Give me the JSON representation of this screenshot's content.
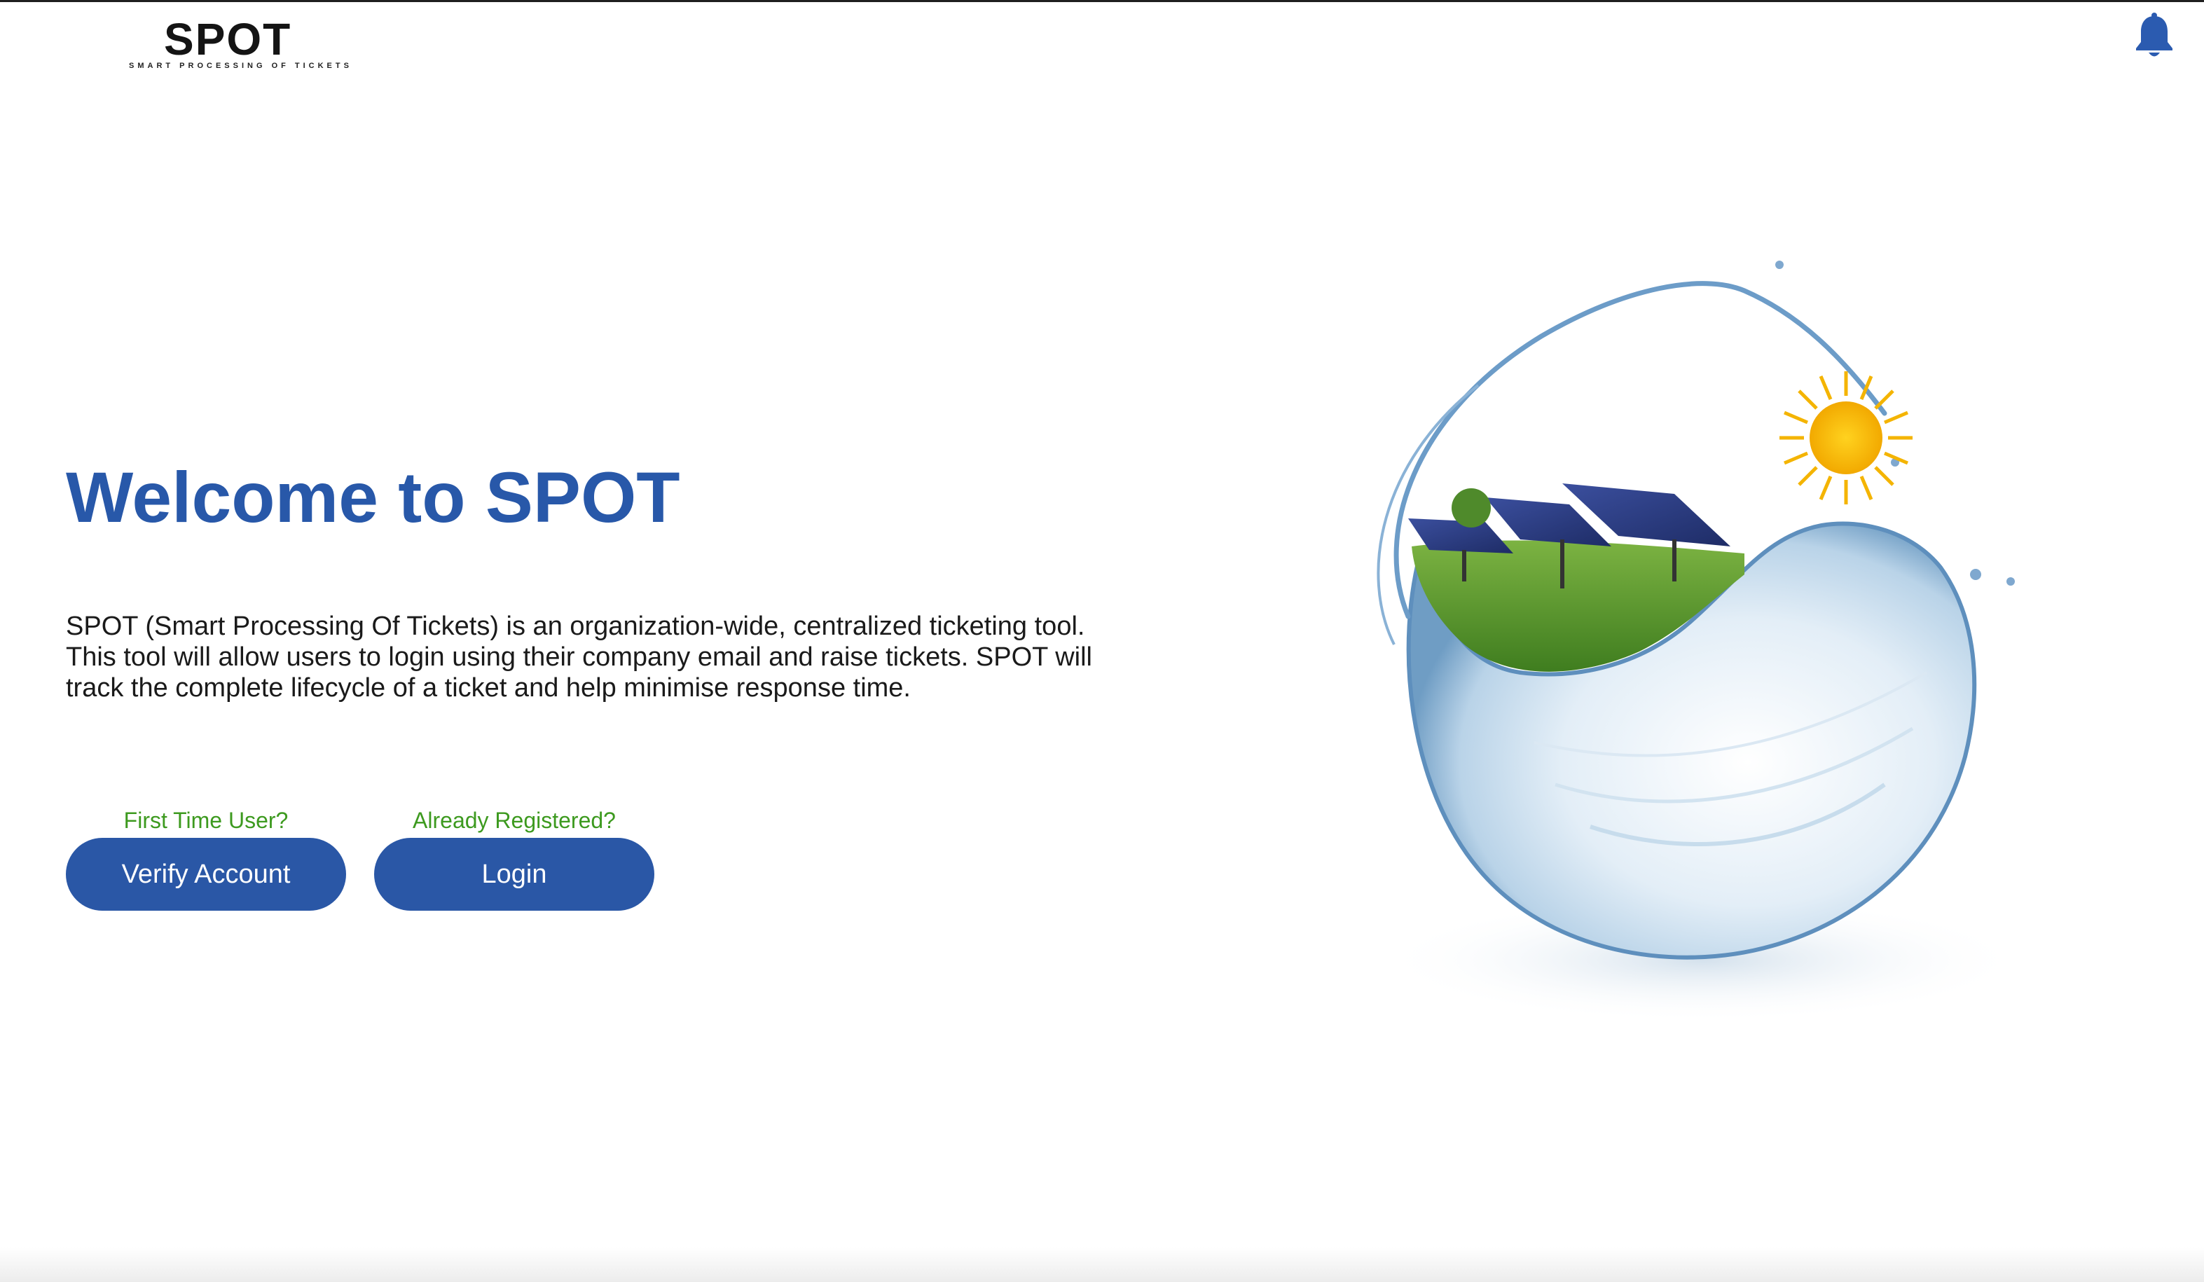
{
  "header": {
    "logo": {
      "wordmark": "SPOT",
      "tagline": "SMART PROCESSING OF TICKETS"
    },
    "notifications_icon": "bell-icon"
  },
  "hero": {
    "title": "Welcome to SPOT",
    "description": "SPOT (Smart Processing Of Tickets) is an organization-wide, centralized ticketing tool. This tool will allow users to login using their company email and raise tickets. SPOT will track the complete lifecycle of a ticket and help minimise response time."
  },
  "actions": {
    "verify": {
      "hint": "First Time User?",
      "label": "Verify Account"
    },
    "login": {
      "hint": "Already Registered?",
      "label": "Login"
    }
  },
  "colors": {
    "brand_blue": "#2858a9",
    "button_blue": "#2a57a6",
    "hint_green": "#3d9a1f",
    "bell_blue": "#2b5bb0"
  }
}
